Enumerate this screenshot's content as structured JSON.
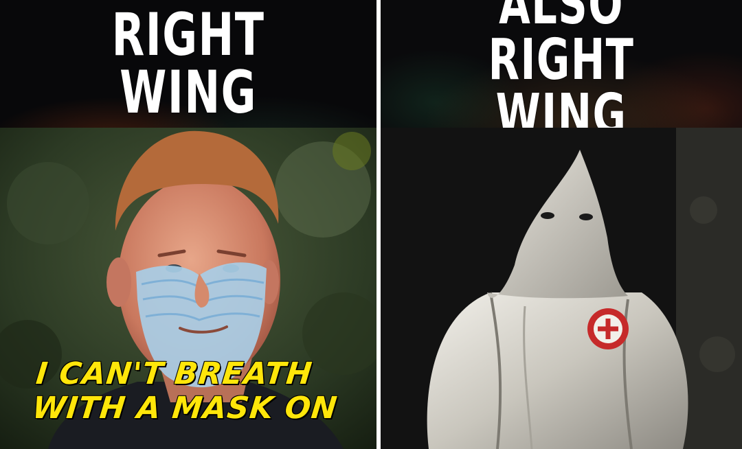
{
  "left_panel": {
    "title": "RIGHT WING",
    "caption_line1": "I CAN'T BREATH",
    "caption_line2": "WITH A MASK ON"
  },
  "right_panel": {
    "title": "ALSO RIGHT WING"
  },
  "colors": {
    "header_bg": "#08080a",
    "title_text": "#ffffff",
    "caption_text": "#ffe60a",
    "divider": "#ffffff"
  }
}
